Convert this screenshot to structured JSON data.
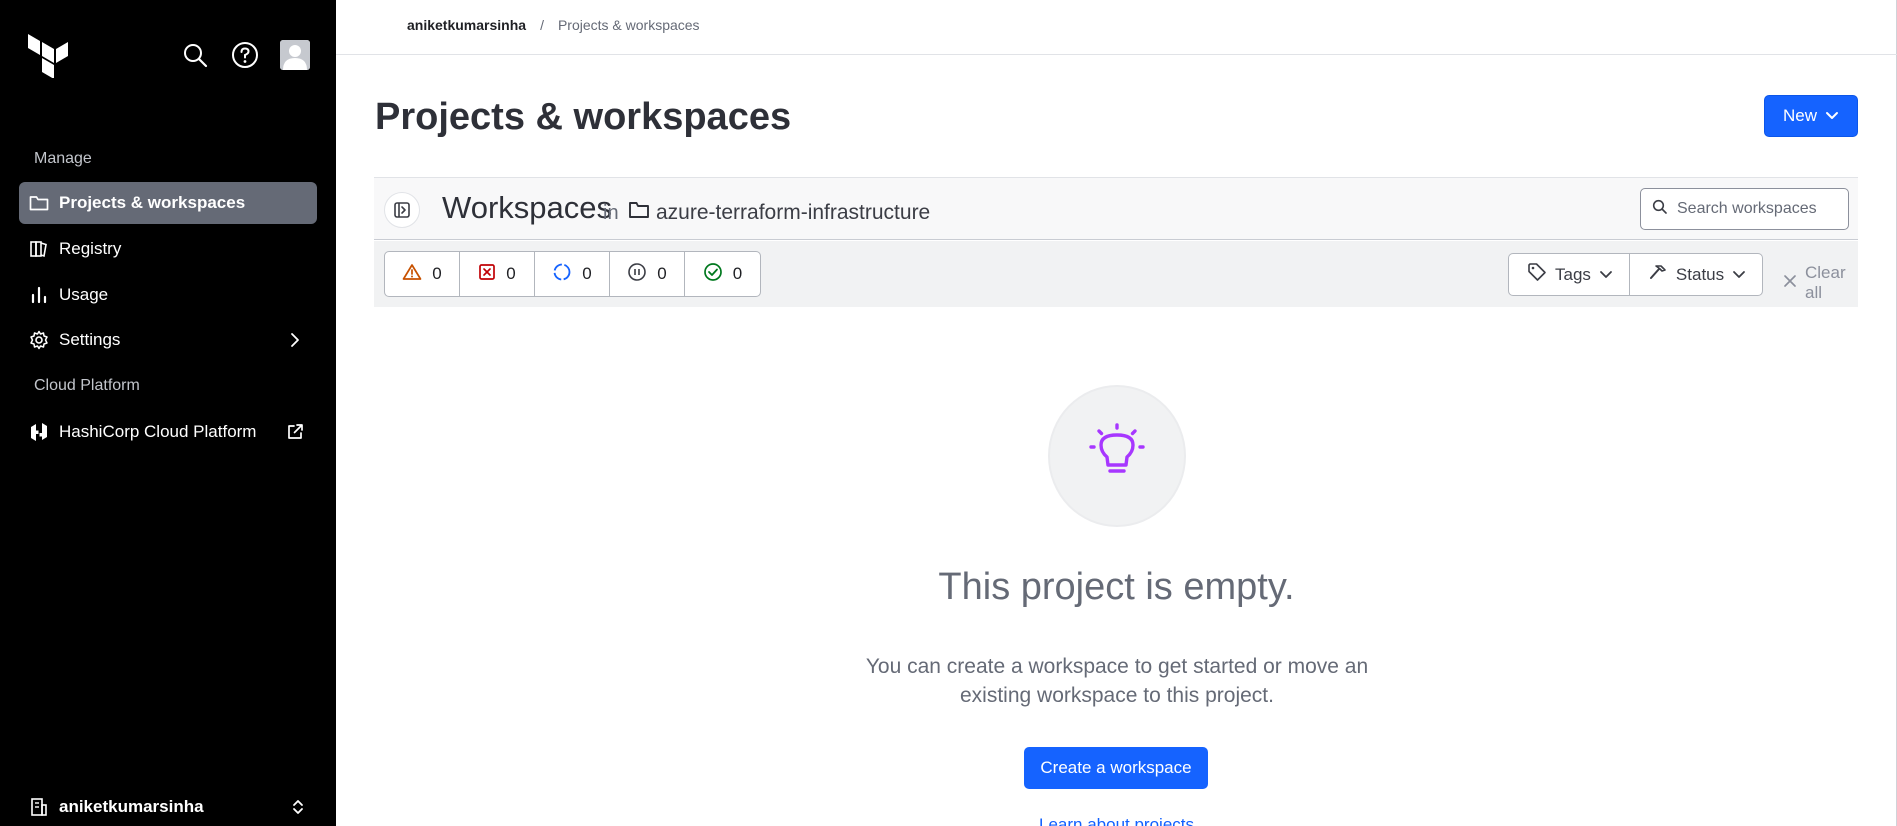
{
  "sidebar": {
    "manage_label": "Manage",
    "items": [
      {
        "label": "Projects & workspaces",
        "icon": "folder-icon",
        "active": true
      },
      {
        "label": "Registry",
        "icon": "registry-icon"
      },
      {
        "label": "Usage",
        "icon": "bar-chart-icon"
      },
      {
        "label": "Settings",
        "icon": "gear-icon"
      }
    ],
    "cloud_label": "Cloud Platform",
    "hcp_label": "HashiCorp Cloud Platform",
    "org_name": "aniketkumarsinha"
  },
  "breadcrumb": {
    "org": "aniketkumarsinha",
    "separator": "/",
    "current": "Projects & workspaces"
  },
  "page": {
    "title": "Projects & workspaces",
    "new_button": "New"
  },
  "workspaces": {
    "title": "Workspaces",
    "in_label": "in",
    "project_name": "azure-terraform-infrastructure",
    "search_placeholder": "Search workspaces"
  },
  "filters": {
    "status_counts": [
      {
        "icon": "warning-icon",
        "count": "0",
        "color": "#c75100"
      },
      {
        "icon": "error-icon",
        "count": "0",
        "color": "#c00005"
      },
      {
        "icon": "running-icon",
        "count": "0",
        "color": "#1563ff"
      },
      {
        "icon": "paused-icon",
        "count": "0",
        "color": "#656a76"
      },
      {
        "icon": "success-icon",
        "count": "0",
        "color": "#00781e"
      }
    ],
    "tags_label": "Tags",
    "status_label": "Status",
    "clear_all_label": "Clear all"
  },
  "empty_state": {
    "title": "This project is empty.",
    "description": "You can create a workspace to get started or move an existing workspace to this project.",
    "create_button": "Create a workspace",
    "link_text": "Learn about projects"
  },
  "colors": {
    "accent": "#1563ff",
    "sidebar_bg": "#000000",
    "active_item": "#656a76",
    "empty_icon": "#a737ff"
  }
}
